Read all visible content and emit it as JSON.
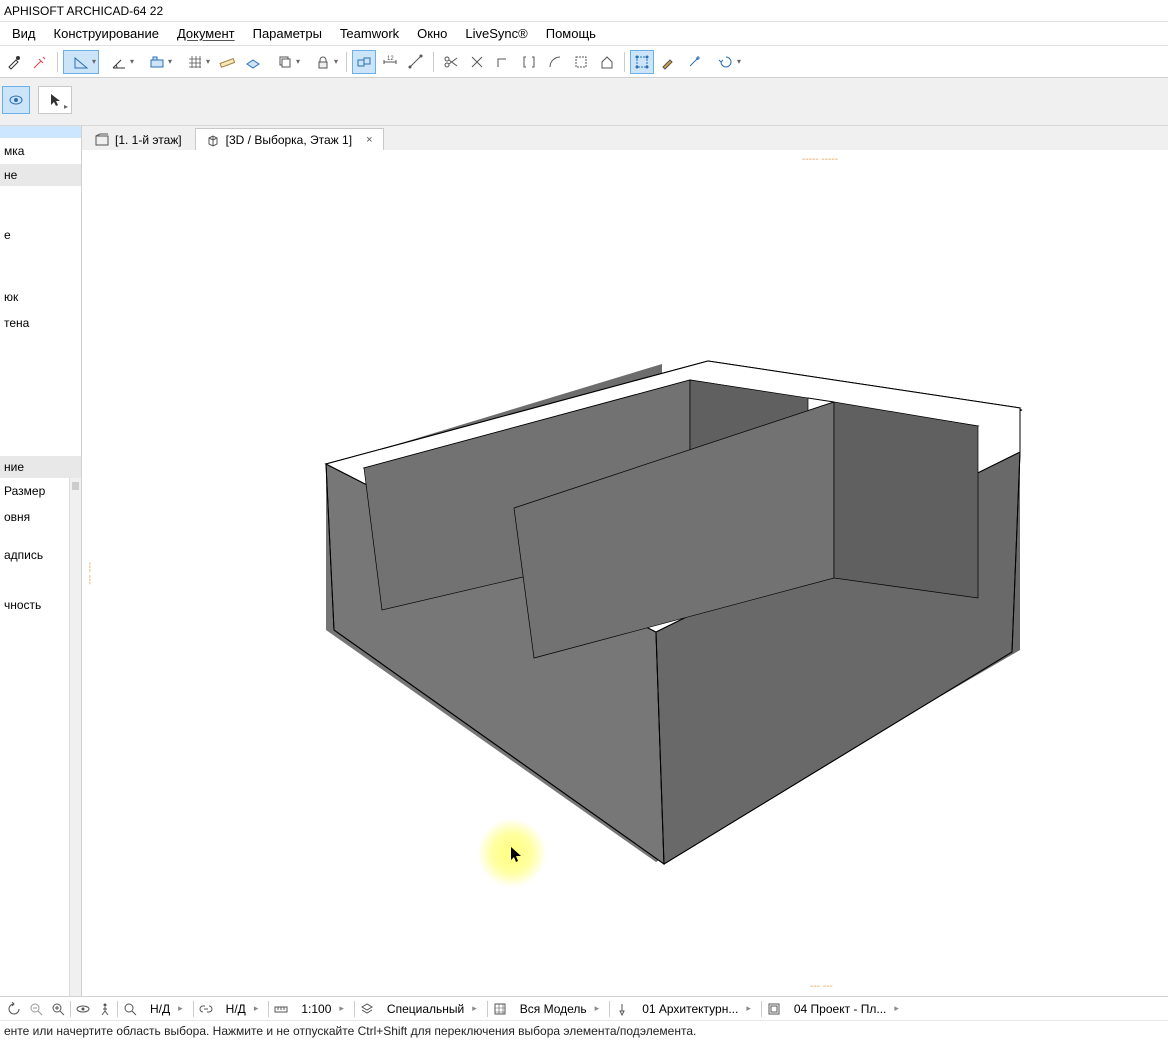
{
  "title": "APHISOFT ARCHICAD-64 22",
  "menu": [
    "Вид",
    "Конструирование",
    "Документ",
    "Параметры",
    "Teamwork",
    "Окно",
    "LiveSync®",
    "Помощь"
  ],
  "tabs": [
    {
      "label": "[1. 1-й этаж]"
    },
    {
      "label": "[3D / Выборка, Этаж 1]",
      "closable": true,
      "active": true
    }
  ],
  "sidebar": {
    "items_top": [
      {
        "label": "",
        "sel": true
      },
      {
        "label": "мка"
      },
      {
        "label": "не",
        "header": true
      },
      {
        "label": ""
      },
      {
        "label": ""
      },
      {
        "label": ""
      },
      {
        "label": "е"
      },
      {
        "label": ""
      },
      {
        "label": ""
      },
      {
        "label": ""
      },
      {
        "label": "юк"
      },
      {
        "label": "тена"
      }
    ],
    "section2_header": "ние",
    "items_bot": [
      "Размер",
      "овня",
      "",
      "адпись",
      "",
      "",
      "чность"
    ]
  },
  "statusbar": {
    "nd1": "Н/Д",
    "nd2": "Н/Д",
    "scale": "1:100",
    "special": "Специальный",
    "model": "Вся Модель",
    "arch_set": "01 Архитектурн...",
    "project": "04 Проект - Пл..."
  },
  "hint": "енте или начертите область выбора. Нажмите и не отпускайте Ctrl+Shift для переключения выбора элемента/подэлемента."
}
